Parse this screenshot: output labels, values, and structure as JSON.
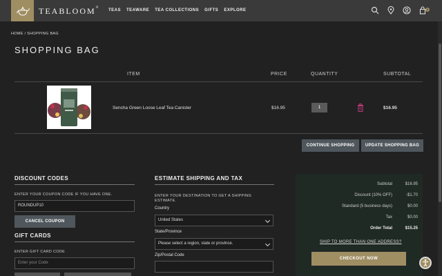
{
  "header": {
    "brand": "TEABLOOM",
    "brand_mark": "®",
    "nav": [
      "TEAS",
      "TEAWARE",
      "TEA COLLECTIONS",
      "GIFTS",
      "EXPLORE"
    ],
    "icons": [
      "search-icon",
      "location-icon",
      "account-icon",
      "cart-icon"
    ],
    "cart_count": "0"
  },
  "breadcrumb": "HOME / SHOPPING BAG",
  "page_title": "SHOPPING BAG",
  "table": {
    "headers": {
      "item": "ITEM",
      "price": "PRICE",
      "quantity": "QUANTITY",
      "subtotal": "SUBTOTAL"
    },
    "rows": [
      {
        "name": "Sencha Green Loose Leaf Tea Canister",
        "price": "$16.95",
        "quantity": "1",
        "subtotal": "$16.95"
      }
    ]
  },
  "buttons": {
    "continue": "CONTINUE SHOPPING",
    "update": "UPDATE SHOPPING BAG",
    "cancel_coupon": "CANCEL COUPON",
    "checkout": "CHECKOUT NOW"
  },
  "discount": {
    "heading": "DISCOUNT CODES",
    "prompt": "ENTER YOUR COUPON CODE IF YOU HAVE ONE.",
    "code": "ROUNDUP10"
  },
  "gift": {
    "heading": "GIFT CARDS",
    "prompt": "ENTER GIFT CARD CODE",
    "placeholder": "Enter your Code"
  },
  "shipping": {
    "heading": "ESTIMATE SHIPPING AND TAX",
    "prompt": "ENTER YOUR DESTINATION TO GET A SHIPPING ESTIMATE.",
    "country_label": "Country",
    "country": "United States",
    "state_label": "State/Province",
    "state": "Please select a region, state or province.",
    "zip_label": "Zip/Postal Code"
  },
  "summary": {
    "rows": [
      {
        "label": "Subtotal",
        "value": "$16.95"
      },
      {
        "label": "Discount (10% OFF)",
        "value": "-$1.70"
      },
      {
        "label": "Standard (5 business days)",
        "value": "$0.00"
      },
      {
        "label": "Tax",
        "value": "$0.00"
      },
      {
        "label": "Order Total",
        "value": "$15.25"
      }
    ],
    "multi_ship": "SHIP TO MORE THAN ONE ADDRESS?"
  },
  "colors": {
    "accent": "#a08e63",
    "topbar": "#3a3a3a",
    "background": "#212121",
    "summary_bg": "#202a25",
    "trash": "#c0397a"
  }
}
